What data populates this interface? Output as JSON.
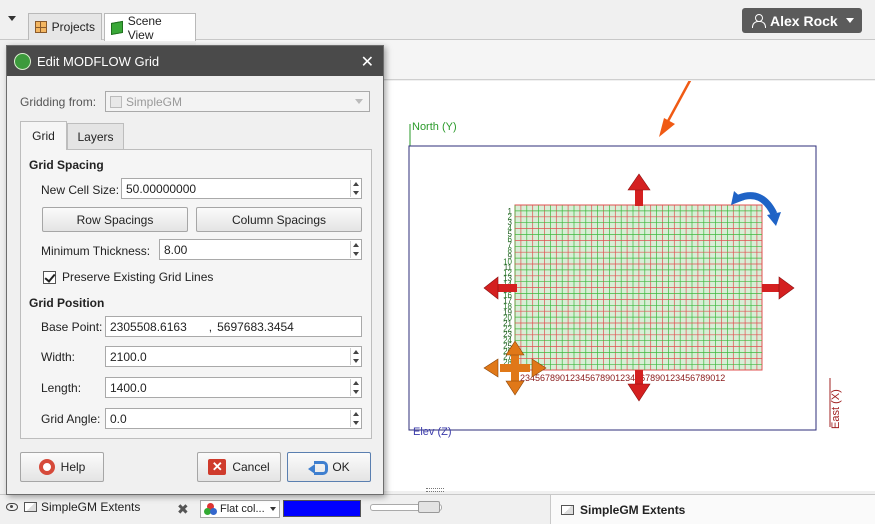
{
  "tabs": [
    {
      "label": "Projects",
      "icon": "grid-icon"
    },
    {
      "label": "Scene View",
      "icon": "cube-icon"
    }
  ],
  "user": {
    "name": "Alex Rock"
  },
  "dialog": {
    "title": "Edit MODFLOW Grid",
    "gridding_from_label": "Gridding from:",
    "gridding_from_value": "SimpleGM",
    "tabs": [
      "Grid",
      "Layers"
    ],
    "grid_spacing_heading": "Grid Spacing",
    "new_cell_size_label": "New Cell Size:",
    "new_cell_size_value": "50.00000000",
    "row_spacings_button": "Row Spacings",
    "column_spacings_button": "Column Spacings",
    "minimum_thickness_label": "Minimum Thickness:",
    "minimum_thickness_value": "8.00",
    "preserve_label": "Preserve Existing Grid Lines",
    "preserve_checked": true,
    "grid_position_heading": "Grid Position",
    "base_point_label": "Base Point:",
    "base_point_x": "2305508.6163",
    "base_point_sep": ",",
    "base_point_y": "5697683.3454",
    "width_label": "Width:",
    "width_value": "2100.0",
    "length_label": "Length:",
    "length_value": "1400.0",
    "grid_angle_label": "Grid Angle:",
    "grid_angle_value": "0.0",
    "help_button": "Help",
    "cancel_button": "Cancel",
    "ok_button": "OK"
  },
  "scene": {
    "north_label": "North (Y)",
    "east_label": "East (X)",
    "elev_label": "Elev (Z)",
    "col_numbers": "23456789012345678901234567890123456789012",
    "row_numbers": [
      "1",
      "2",
      "3",
      "4",
      "5",
      "6",
      "7",
      "8",
      "9",
      "10",
      "11",
      "12",
      "13",
      "14",
      "15",
      "16",
      "17",
      "18",
      "19",
      "20",
      "21",
      "22",
      "23",
      "24",
      "25",
      "26",
      "27",
      "28"
    ],
    "colors": {
      "north": "#2a9a2a",
      "east": "#a02020",
      "elev": "#3a3aaa",
      "grid_green": "#3cb83c",
      "grid_red": "#e05050",
      "arrow_red": "#d42020",
      "arrow_orange": "#e07818",
      "rotate_blue": "#1f63c6",
      "pointer": "#f05a14"
    }
  },
  "bottom": {
    "layer_name": "SimpleGM Extents",
    "shading_value": "Flat col...",
    "color_value": "#0000ff",
    "properties_title": "SimpleGM Extents"
  }
}
